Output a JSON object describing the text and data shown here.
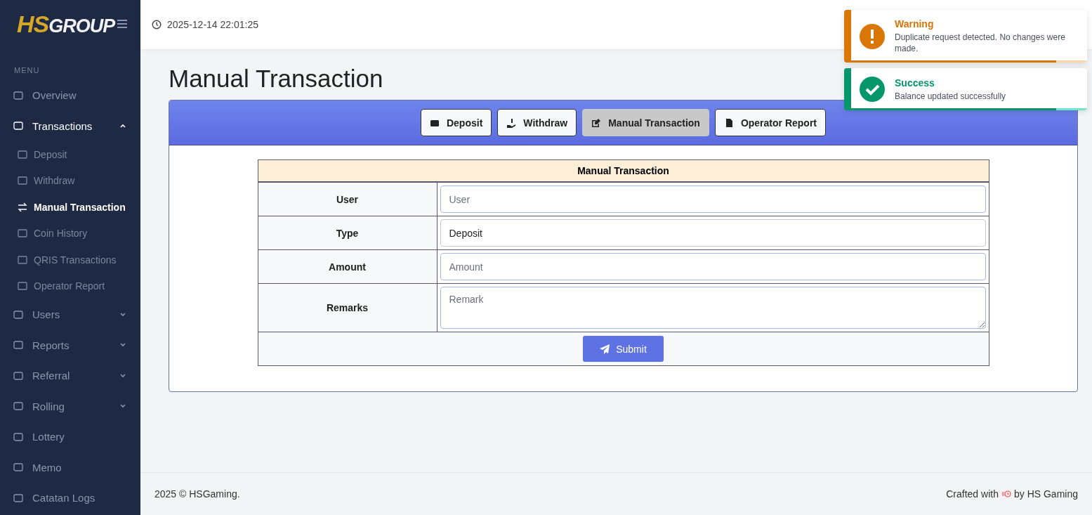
{
  "sidebar": {
    "logo": {
      "mark": "HS",
      "word": "GROUP"
    },
    "menu_label": "MENU",
    "items": [
      {
        "label": "Overview",
        "expandable": false,
        "expanded": false
      },
      {
        "label": "Transactions",
        "expandable": true,
        "expanded": true,
        "children": [
          {
            "label": "Deposit",
            "selected": false
          },
          {
            "label": "Withdraw",
            "selected": false
          },
          {
            "label": "Manual Transaction",
            "selected": true
          },
          {
            "label": "Coin History",
            "selected": false
          },
          {
            "label": "QRIS Transactions",
            "selected": false
          },
          {
            "label": "Operator Report",
            "selected": false
          }
        ]
      },
      {
        "label": "Users",
        "expandable": true,
        "expanded": false
      },
      {
        "label": "Reports",
        "expandable": true,
        "expanded": false
      },
      {
        "label": "Referral",
        "expandable": true,
        "expanded": false
      },
      {
        "label": "Rolling",
        "expandable": true,
        "expanded": false
      },
      {
        "label": "Lottery",
        "expandable": false,
        "expanded": false
      },
      {
        "label": "Memo",
        "expandable": false,
        "expanded": false
      },
      {
        "label": "Catatan Logs",
        "expandable": false,
        "expanded": false
      }
    ]
  },
  "header": {
    "datetime": "2025-12-14 22:01:25"
  },
  "page_title": "Manual Transaction",
  "tabs": [
    {
      "label": "Deposit",
      "selected": false
    },
    {
      "label": "Withdraw",
      "selected": false
    },
    {
      "label": "Manual Transaction",
      "selected": true
    },
    {
      "label": "Operator Report",
      "selected": false
    }
  ],
  "form": {
    "title": "Manual Transaction",
    "fields": [
      {
        "label": "User",
        "kind": "input",
        "placeholder": "User"
      },
      {
        "label": "Type",
        "kind": "select",
        "value": "Deposit"
      },
      {
        "label": "Amount",
        "kind": "input",
        "placeholder": "Amount"
      },
      {
        "label": "Remarks",
        "kind": "textarea",
        "placeholder": "Remark"
      }
    ],
    "submit": "Submit"
  },
  "toasts": [
    {
      "kind": "warning",
      "title": "Warning",
      "message": "Duplicate request detected. No changes were made.",
      "level": 0.87
    },
    {
      "kind": "success",
      "title": "Success",
      "message": "Balance updated successfully",
      "level": 0.87
    }
  ],
  "footer": {
    "left": "2025 © HSGaming.",
    "crafted": "Crafted with",
    "by": "by HS Gaming"
  }
}
